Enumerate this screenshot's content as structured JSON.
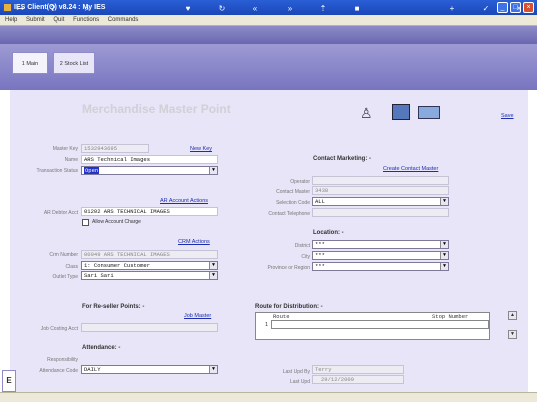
{
  "window": {
    "title": "IES Client(Q) v8.24 : My IES"
  },
  "menu": [
    "Help",
    "Submit",
    "Quit",
    "Functions",
    "Commands"
  ],
  "tabs": [
    {
      "label": "1 Main"
    },
    {
      "label": "2 Stock List"
    }
  ],
  "page": {
    "title": "Merchandise Master Point",
    "save_label": "Save"
  },
  "form": {
    "master_key": {
      "label": "Master Key",
      "value": "1532943695"
    },
    "new_key_label": "New Key",
    "name": {
      "label": "Name",
      "value": "ARS Technical Images"
    },
    "transaction_status": {
      "label": "Transaction Status",
      "value": "Open"
    },
    "ar_account_actions_label": "AR Account Actions",
    "ar_debtor_acct": {
      "label": "AR Debtor Acct",
      "value": "01202 ARS TECHNICAL IMAGES"
    },
    "allow_account_charge": {
      "label": "Allow Account Charge",
      "checked": false
    },
    "crm_actions_label": "CRM Actions",
    "crm_number": {
      "label": "Crm Number",
      "value": "00049 ARS TECHNICAL IMAGES"
    },
    "class": {
      "label": "Class",
      "value": "1: Consumer Customer"
    },
    "outlet_type": {
      "label": "Outlet Type",
      "value": "Sari Sari"
    },
    "reseller_section": "For Re-seller Points: -",
    "job_master_label": "Job Master",
    "job_costing_acct": {
      "label": "Job Costing Acct",
      "value": ""
    },
    "attendance_section": "Attendance: -",
    "responsibility": {
      "label": "Responsibility",
      "value": ""
    },
    "attendance_code": {
      "label": "Attendance Code",
      "value": "DAILY"
    }
  },
  "contact": {
    "section": "Contact Marketing: -",
    "create_label": "Create Contact Master",
    "operator": {
      "label": "Operator",
      "value": ""
    },
    "contact_master": {
      "label": "Contact Master",
      "value": "3438"
    },
    "selection_code": {
      "label": "Selection Code",
      "value": "ALL"
    },
    "contact_telephone": {
      "label": "Contact Telephone",
      "value": ""
    }
  },
  "location": {
    "section": "Location: -",
    "district": {
      "label": "District",
      "value": "***"
    },
    "city": {
      "label": "City",
      "value": "***"
    },
    "province": {
      "label": "Province or Region",
      "value": "***"
    }
  },
  "route": {
    "section": "Route for Distribution: -",
    "columns": [
      "Route",
      "Stop Number"
    ],
    "rows": [
      {
        "index": "1",
        "route": "",
        "stop": ""
      }
    ]
  },
  "audit": {
    "last_upd_by": {
      "label": "Last Upd By",
      "value": "Terry"
    },
    "last_upd": {
      "label": "Last Upd",
      "value": "29/12/2009"
    }
  },
  "colors": {
    "title_bar": "#1b47b8",
    "panel": "#e7e5f7",
    "link": "#1e2db0",
    "toolbar": "#7875c0"
  }
}
